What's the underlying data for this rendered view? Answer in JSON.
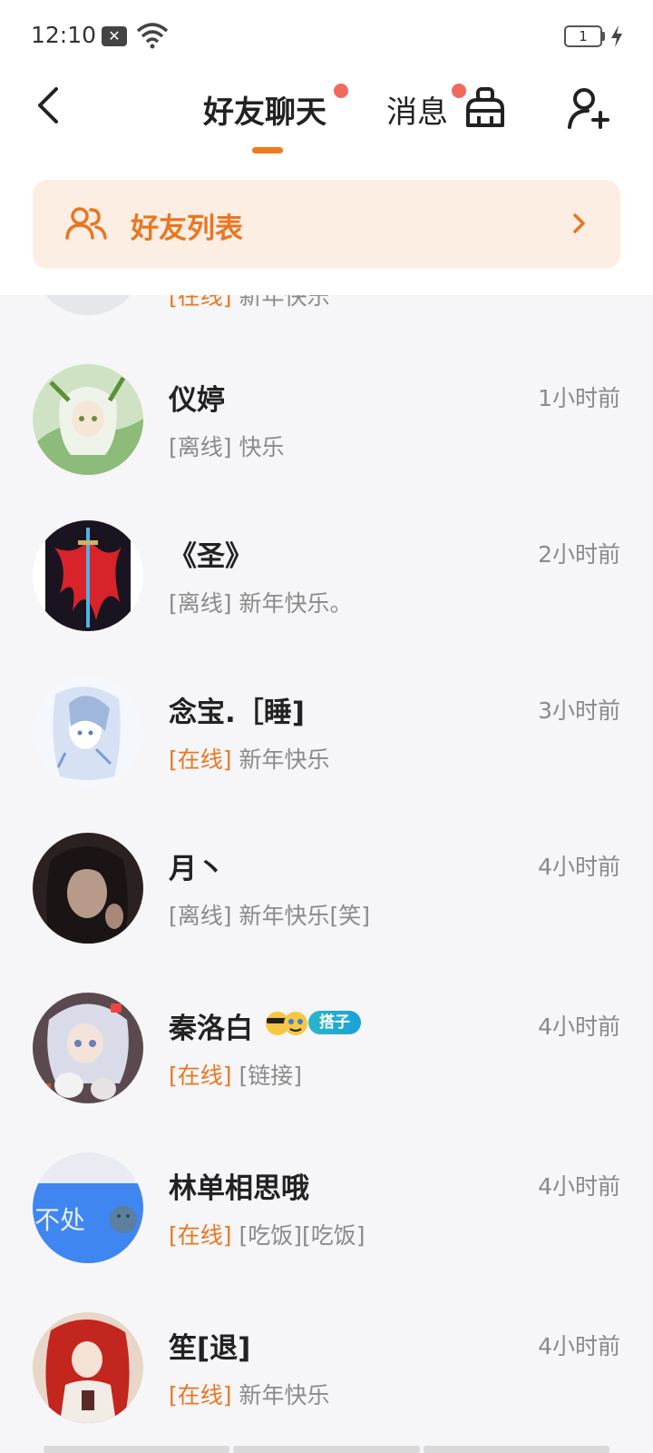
{
  "status_bar": {
    "time": "12:10",
    "battery": "1"
  },
  "header": {
    "tabs": [
      {
        "label": "好友聊天",
        "active": true,
        "has_dot": true
      },
      {
        "label": "消息",
        "active": false,
        "has_dot": true
      }
    ],
    "icons": [
      "back-icon",
      "clean-icon",
      "add-user-icon"
    ]
  },
  "banner": {
    "label": "好友列表"
  },
  "partial_row": {
    "status": "[在线]",
    "message": "新年快乐"
  },
  "friends": [
    {
      "name": "仪婷",
      "time": "1小时前",
      "status": "[离线]",
      "message": "快乐",
      "online": false
    },
    {
      "name": "《圣》",
      "time": "2小时前",
      "status": "[离线]",
      "message": "新年快乐。",
      "online": false
    },
    {
      "name": "念宝.［睡]",
      "time": "3小时前",
      "status": "[在线]",
      "message": "新年快乐",
      "online": true
    },
    {
      "name": "月丶",
      "time": "4小时前",
      "status": "[离线]",
      "message": "新年快乐[笑]",
      "online": false
    },
    {
      "name": "秦洛白",
      "time": "4小时前",
      "status": "[在线]",
      "message": "[链接]",
      "online": true,
      "tag": "搭子"
    },
    {
      "name": "林单相思哦",
      "time": "4小时前",
      "status": "[在线]",
      "message": "[吃饭][吃饭]",
      "online": true,
      "avatar_text": "不处"
    },
    {
      "name": "笙[退]",
      "time": "4小时前",
      "status": "[在线]",
      "message": "新年快乐",
      "online": true
    }
  ],
  "colors": {
    "accent": "#e87722",
    "dot": "#f06a5b",
    "banner_bg": "#fdeee4"
  }
}
